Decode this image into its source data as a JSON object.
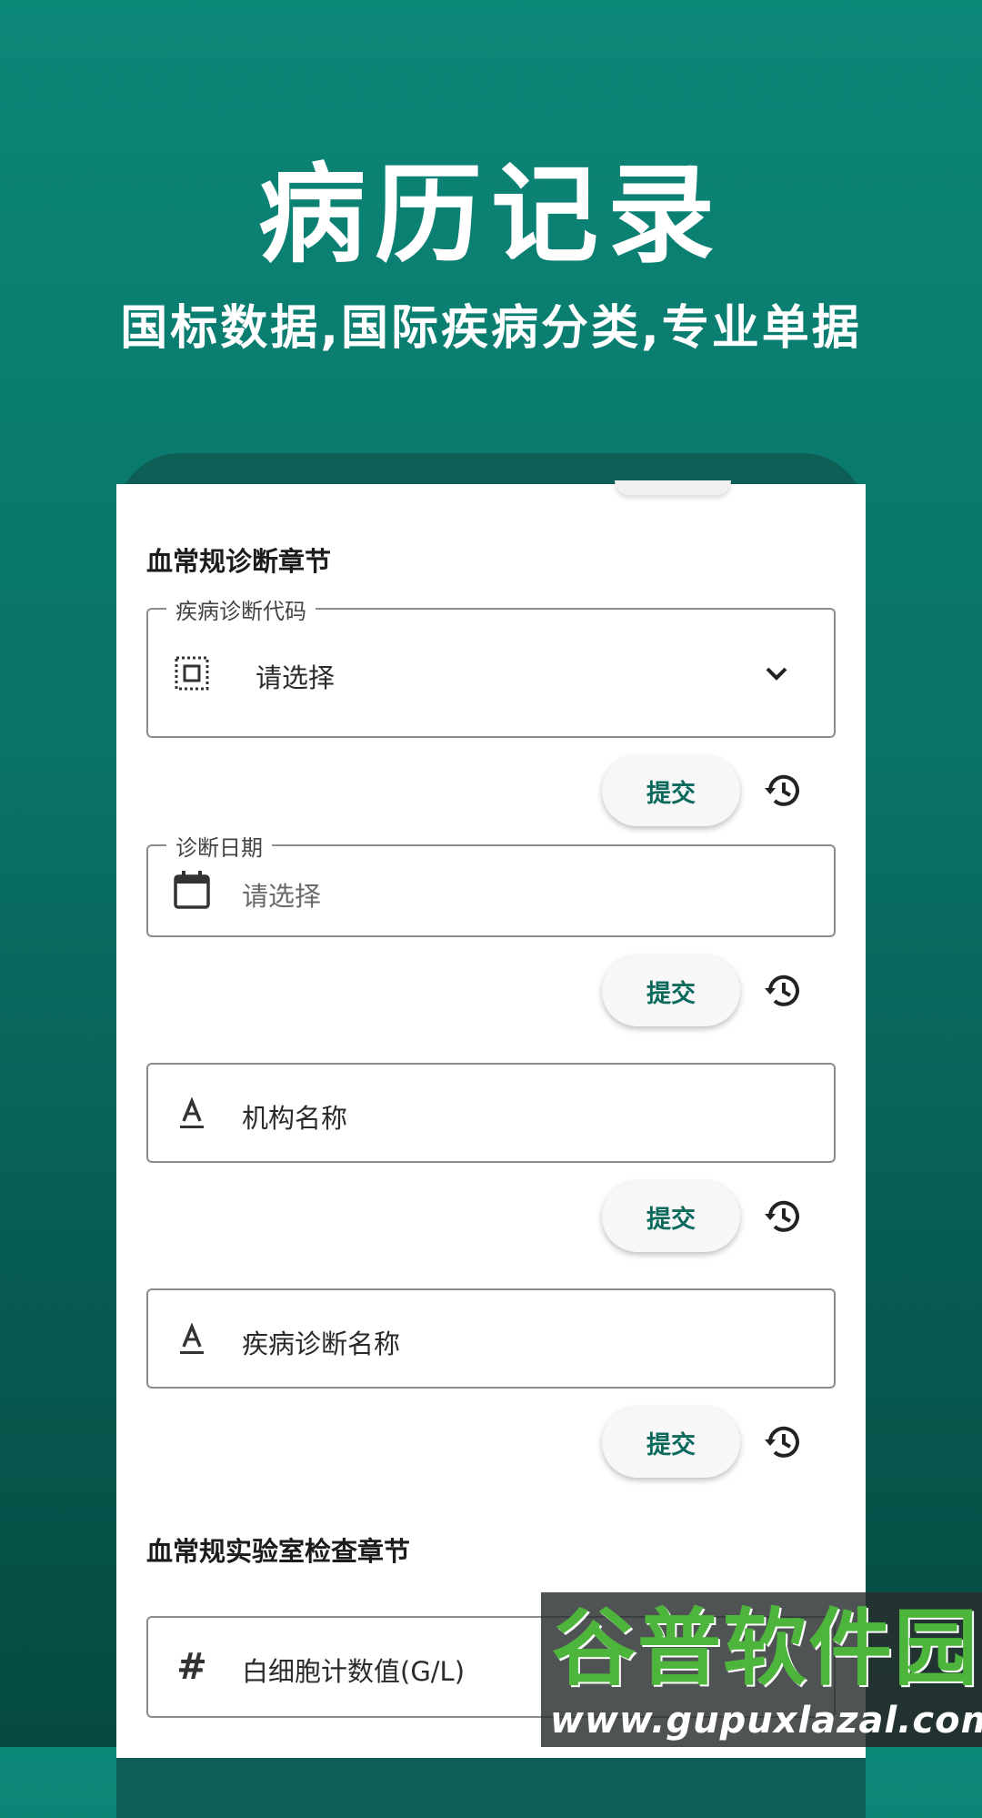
{
  "hero": {
    "title": "病历记录",
    "subtitle": "国标数据,国际疾病分类,专业单据"
  },
  "form": {
    "section1_title": "血常规诊断章节",
    "fields": [
      {
        "legend": "疾病诊断代码",
        "value": "请选择",
        "icon": "barcode-scan-icon",
        "dropdown": true
      },
      {
        "legend": "诊断日期",
        "value": "请选择",
        "icon": "calendar-icon"
      },
      {
        "legend": "",
        "value": "机构名称",
        "icon": "text-format-icon"
      },
      {
        "legend": "",
        "value": "疾病诊断名称",
        "icon": "text-format-icon"
      }
    ],
    "submit_label": "提交",
    "section2_title": "血常规实验室检查章节",
    "lab_field": {
      "value": "白细胞计数值(G/L)",
      "icon": "hash-icon"
    }
  },
  "watermark": {
    "title": "谷普软件园",
    "url": "www.gupuxlazal.com"
  },
  "colors": {
    "primary": "#0b8778",
    "accent_text": "#0c6a5d"
  }
}
